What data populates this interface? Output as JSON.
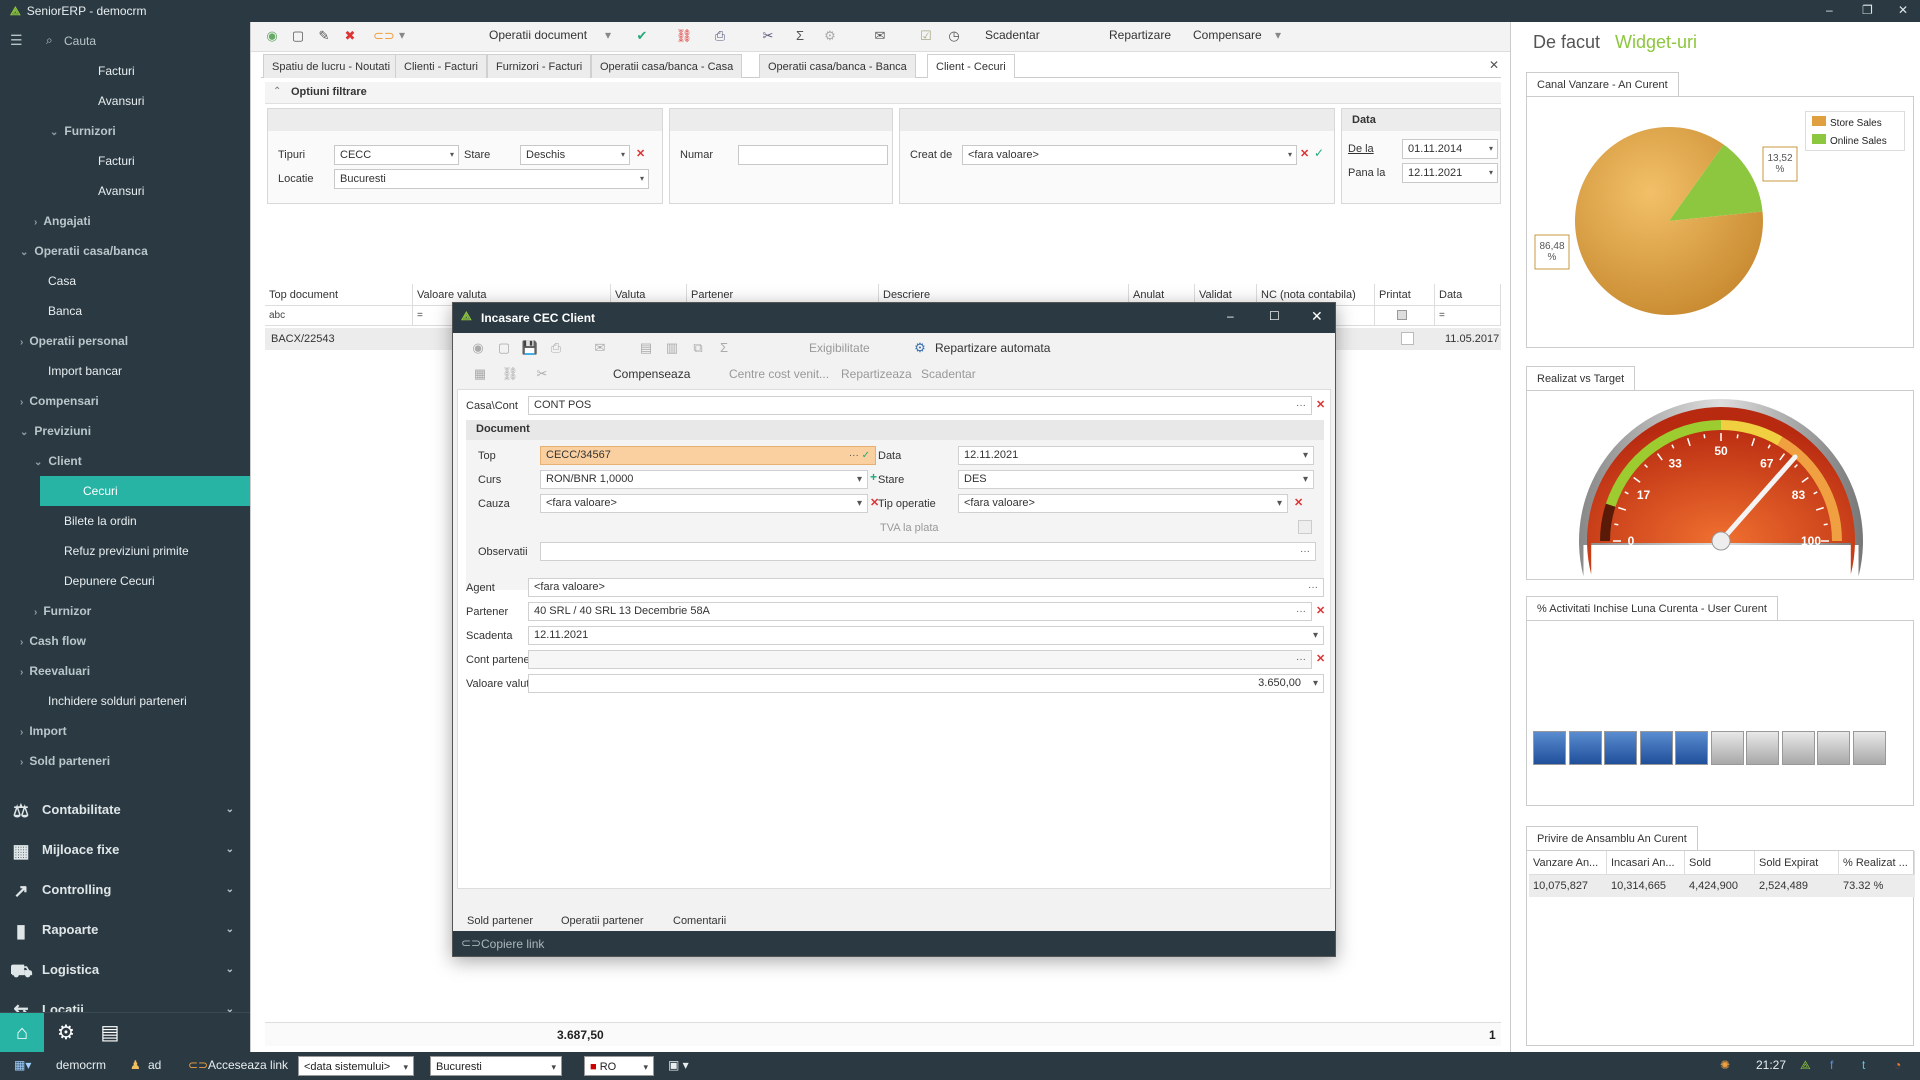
{
  "app": {
    "title": "SeniorERP - democrm",
    "window_controls": [
      "–",
      "❐",
      "✕"
    ]
  },
  "sidebar": {
    "search_placeholder": "Cauta",
    "items": [
      {
        "label": "Facturi",
        "indent": 4
      },
      {
        "label": "Avansuri",
        "indent": 4
      },
      {
        "label": "Furnizori",
        "indent": 3,
        "section": true,
        "chev": "⌄"
      },
      {
        "label": "Facturi",
        "indent": 4
      },
      {
        "label": "Avansuri",
        "indent": 4
      },
      {
        "label": "Angajati",
        "indent": 2,
        "section": true,
        "chev": "›"
      },
      {
        "label": "Operatii casa/banca",
        "indent": 1,
        "section": true,
        "chev": "⌄"
      },
      {
        "label": "Casa",
        "indent": 2
      },
      {
        "label": "Banca",
        "indent": 2
      },
      {
        "label": "Operatii personal",
        "indent": 1,
        "section": true,
        "chev": "›"
      },
      {
        "label": "Import bancar",
        "indent": 2
      },
      {
        "label": "Compensari",
        "indent": 1,
        "section": true,
        "chev": "›"
      },
      {
        "label": "Previziuni",
        "indent": 1,
        "section": true,
        "chev": "⌄"
      },
      {
        "label": "Client",
        "indent": 2,
        "section": true,
        "chev": "⌄"
      },
      {
        "label": "Cecuri",
        "indent": 3,
        "selected": true
      },
      {
        "label": "Bilete la ordin",
        "indent": 3
      },
      {
        "label": "Refuz previziuni primite",
        "indent": 3
      },
      {
        "label": "Depunere Cecuri",
        "indent": 3
      },
      {
        "label": "Furnizor",
        "indent": 2,
        "section": true,
        "chev": "›"
      },
      {
        "label": "Cash flow",
        "indent": 1,
        "section": true,
        "chev": "›"
      },
      {
        "label": "Reevaluari",
        "indent": 1,
        "section": true,
        "chev": "›"
      },
      {
        "label": "Inchidere solduri parteneri",
        "indent": 2
      },
      {
        "label": "Import",
        "indent": 1,
        "section": true,
        "chev": "›"
      },
      {
        "label": "Sold parteneri",
        "indent": 1,
        "section": true,
        "chev": "›"
      }
    ],
    "modules": [
      {
        "label": "Contabilitate",
        "icon": "⚖"
      },
      {
        "label": "Mijloace fixe",
        "icon": "▦"
      },
      {
        "label": "Controlling",
        "icon": "↗"
      },
      {
        "label": "Rapoarte",
        "icon": "▮"
      },
      {
        "label": "Logistica",
        "icon": "⛟"
      },
      {
        "label": "Locatii",
        "icon": "⇆"
      }
    ]
  },
  "statusbar": {
    "user_db": "democrm",
    "user": "ad",
    "link": "Acceseaza link",
    "date": "<data sistemului>",
    "location": "Bucuresti",
    "lang": "RO",
    "time": "21:27"
  },
  "toolbar": {
    "operatii_document": "Operatii document",
    "scadentar": "Scadentar",
    "repartizare": "Repartizare",
    "compensare": "Compensare"
  },
  "tabs": [
    "Spatiu de lucru - Noutati",
    "Clienti - Facturi",
    "Furnizori - Facturi",
    "Operatii casa/banca - Casa",
    "Operatii casa/banca - Banca",
    "Client - Cecuri"
  ],
  "filter": {
    "title": "Optiuni filtrare",
    "tipuri_label": "Tipuri",
    "tipuri": "CECC",
    "stare_label": "Stare",
    "stare": "Deschis",
    "locatie_label": "Locatie",
    "locatie": "Bucuresti",
    "numar_label": "Numar",
    "creat_label": "Creat de",
    "creat": "<fara valoare>",
    "data_title": "Data",
    "dela_label": "De la",
    "dela": "01.11.2014",
    "pana_label": "Pana la",
    "pana": "12.11.2021"
  },
  "grid": {
    "columns": [
      "Top document",
      "Valoare valuta",
      "Valuta",
      "Partener",
      "Descriere",
      "Anulat",
      "Validat",
      "NC (nota contabila)",
      "Printat",
      "Data"
    ],
    "filters": [
      "abc",
      "=",
      "=",
      "abc",
      "abc",
      "",
      "",
      "",
      "",
      "="
    ],
    "row": {
      "top": "BACX/22543",
      "data": "11.05.2017"
    },
    "total": "3.687,50",
    "count": "1"
  },
  "dialog": {
    "title": "Incasare CEC Client",
    "toolbar": {
      "exigibilitate": "Exigibilitate",
      "repartizare": "Repartizare automata",
      "compenseaza": "Compenseaza",
      "centre": "Centre cost venit...",
      "repartizeaza": "Repartizeaza",
      "scadentar": "Scadentar"
    },
    "casa_label": "Casa\\Cont",
    "casa": "CONT POS",
    "section": "Document",
    "top_label": "Top",
    "top": "CECC/34567",
    "data_label": "Data",
    "data": "12.11.2021",
    "curs_label": "Curs",
    "curs": "RON/BNR 1,0000",
    "stare_label": "Stare",
    "stare": "DES",
    "cauza_label": "Cauza",
    "cauza": "<fara valoare>",
    "tipop_label": "Tip operatie",
    "tipop": "<fara valoare>",
    "tva_label": "TVA la plata",
    "obs_label": "Observatii",
    "agent_label": "Agent",
    "agent": "<fara valoare>",
    "partener_label": "Partener",
    "partener": "40 SRL / 40 SRL 13 Decembrie 58A",
    "scadenta_label": "Scadenta",
    "scadenta": "12.11.2021",
    "contp_label": "Cont partener",
    "valoare_label": "Valoare valuta",
    "valoare": "3.650,00",
    "bottom_tabs": [
      "Sold partener",
      "Operatii partener",
      "Comentarii"
    ],
    "copy_link": "Copiere link"
  },
  "right": {
    "tab_active": "De facut",
    "tab_other": "Widget-uri",
    "accent": "#8dc63f",
    "w1": {
      "title": "Canal Vanzare - An Curent",
      "legend": [
        "Store Sales",
        "Online Sales"
      ]
    },
    "w2": {
      "title": "Realizat vs Target"
    },
    "w3": {
      "title": "% Activitati Inchise Luna Curenta - User Curent"
    },
    "w4": {
      "title": "Privire de Ansamblu An Curent",
      "headers": [
        "Vanzare An...",
        "Incasari An...",
        "Sold",
        "Sold Expirat",
        "% Realizat ..."
      ],
      "values": [
        "10,075,827",
        "10,314,665",
        "4,424,900",
        "2,524,489",
        "73.32 %"
      ]
    }
  },
  "chart_data": [
    {
      "type": "pie",
      "title": "Canal Vanzare - An Curent",
      "categories": [
        "Store Sales",
        "Online Sales"
      ],
      "values": [
        86.48,
        13.52
      ],
      "labels": [
        "86,48 %",
        "13,52 %"
      ],
      "colors": [
        "#e0a040",
        "#8dc63f"
      ]
    },
    {
      "type": "gauge",
      "title": "Realizat vs Target",
      "ticks": [
        "0",
        "17",
        "33",
        "50",
        "67",
        "83",
        "100"
      ],
      "range": [
        0,
        100
      ],
      "value": 73
    },
    {
      "type": "progress",
      "title": "% Activitati Inchise Luna Curenta - User Curent",
      "segments_total": 10,
      "segments_done": 5
    }
  ]
}
